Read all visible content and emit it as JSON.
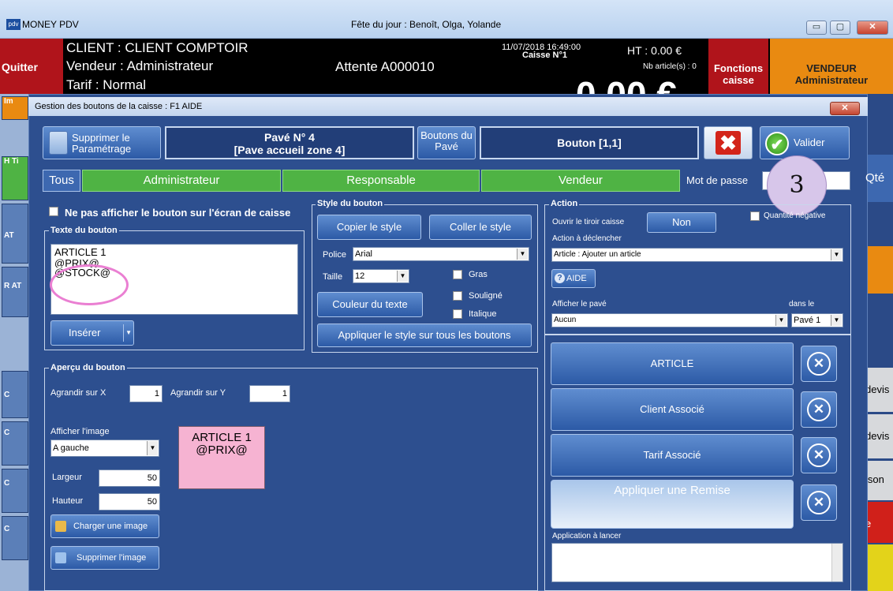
{
  "app": {
    "title": "MONEY PDV",
    "logo_text": "pdv",
    "fete": "Fête du jour : Benoît, Olga, Yolande",
    "win_min": "▭",
    "win_max": "▢",
    "win_close": "✕"
  },
  "header": {
    "quitter": "Quitter",
    "client": "CLIENT : CLIENT COMPTOIR",
    "vendeur": "Vendeur : Administrateur",
    "tarif": "Tarif : Normal",
    "attente": "Attente A000010",
    "datetime": "11/07/2018 16:49:00",
    "caisse": "Caisse N°1",
    "ht": "HT : 0.00 €",
    "nb_article": "Nb article(s) : 0",
    "total": "0.00 €",
    "fonctions_caisse": "Fonctions caisse",
    "vendeur_btn_title": "VENDEUR",
    "vendeur_btn_name": "Administrateur"
  },
  "left_strip": [
    "Im",
    "H Ti",
    "AT",
    "R AT",
    "C",
    "C",
    "C",
    "C"
  ],
  "right_strip": {
    "qte": "Qté",
    "devis1": "devis",
    "devis2": "devis",
    "ison": "ison",
    "e": "e"
  },
  "dialog": {
    "title": "Gestion des boutons de la caisse : F1 AIDE",
    "close": "✕",
    "supprimer_param": "Supprimer le Paramétrage",
    "pave_line1": "Pavé N° 4",
    "pave_line2": "[Pave accueil zone 4]",
    "boutons_pave": "Boutons du Pavé",
    "bouton": "Bouton [1,1]",
    "annuler_icon": "✖",
    "valider": "Valider",
    "valider_icon": "✔"
  },
  "roles": {
    "tous": "Tous",
    "admin": "Administrateur",
    "resp": "Responsable",
    "vendeur": "Vendeur",
    "mot_de_passe": "Mot de passe",
    "badge": "3"
  },
  "texte": {
    "hide_label": "Ne pas afficher le bouton sur l'écran de caisse",
    "panel_title": "Texte du bouton",
    "lines": [
      "ARTICLE 1",
      "@PRIX@",
      "@STOCK@"
    ],
    "inserer": "Insérer",
    "inserer_dd": "▼"
  },
  "style": {
    "panel_title": "Style du bouton",
    "copier": "Copier le style",
    "coller": "Coller le style",
    "police_label": "Police",
    "police_value": "Arial",
    "taille_label": "Taille",
    "taille_value": "12",
    "gras": "Gras",
    "souligne": "Souligné",
    "italique": "Italique",
    "couleur": "Couleur du texte",
    "appliquer_tous": "Appliquer le style sur tous les boutons"
  },
  "apercu": {
    "panel_title": "Aperçu du bouton",
    "agrandir_x_label": "Agrandir sur X",
    "agrandir_x": "1",
    "agrandir_y_label": "Agrandir sur Y",
    "agrandir_y": "1",
    "afficher_image_label": "Afficher l'image",
    "afficher_image_value": "A gauche",
    "largeur_label": "Largeur",
    "largeur": "50",
    "hauteur_label": "Hauteur",
    "hauteur": "50",
    "charger": "Charger une image",
    "supprimer_image": "Supprimer l'image",
    "preview_line1": "ARTICLE 1",
    "preview_line2": "@PRIX@"
  },
  "action": {
    "panel_title": "Action",
    "ouvrir_tiroir": "Ouvrir le tiroir caisse",
    "tiroir_value": "Non",
    "quantite_negative": "Quantité négative",
    "declencher_label": "Action à déclencher",
    "declencher_value": "Article : Ajouter un article",
    "aide": "AIDE",
    "aide_icon": "?",
    "afficher_pave_label": "Afficher le pavé",
    "afficher_pave_value": "Aucun",
    "dans_le_label": "dans le",
    "dans_le_value": "Pavé 1",
    "list": [
      "ARTICLE",
      "Client Associé",
      "Tarif Associé"
    ],
    "remise": "Appliquer une Remise",
    "x_icon": "✕",
    "application_label": "Application à lancer"
  }
}
